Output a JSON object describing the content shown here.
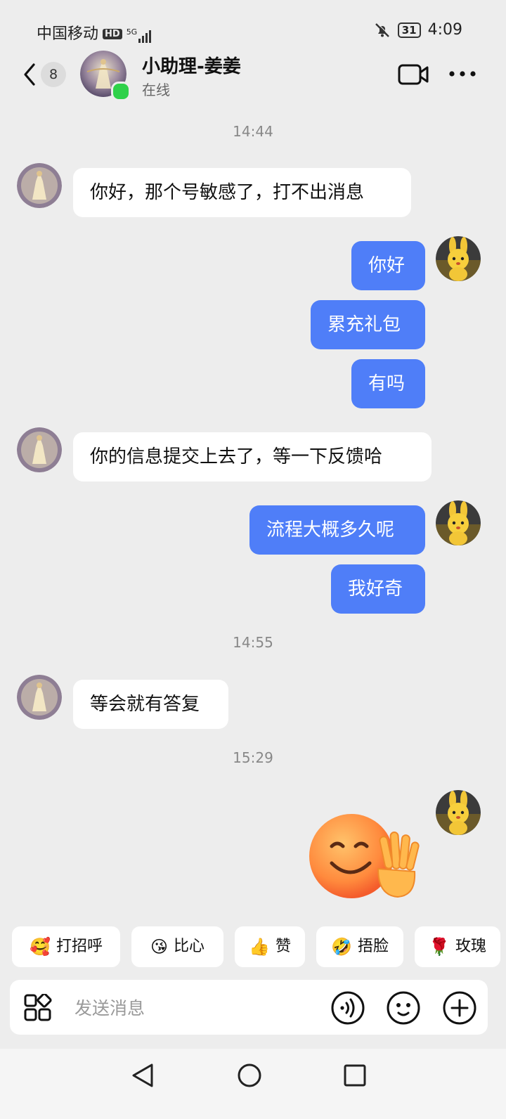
{
  "status_bar": {
    "carrier": "中国移动",
    "hd": "HD",
    "network": "5G",
    "battery": "31",
    "time": "4:09"
  },
  "header": {
    "unread_count": "8",
    "contact_name": "小助理-姜姜",
    "contact_status": "在线"
  },
  "messages": [
    {
      "type": "time",
      "text": "14:44"
    },
    {
      "type": "in",
      "text": "你好，那个号敏感了，打不出消息"
    },
    {
      "type": "out",
      "text": "你好"
    },
    {
      "type": "out",
      "text": "累充礼包"
    },
    {
      "type": "out",
      "text": "有吗"
    },
    {
      "type": "in",
      "text": "你的信息提交上去了，等一下反馈哈"
    },
    {
      "type": "out",
      "text": "流程大概多久呢"
    },
    {
      "type": "out",
      "text": "我好奇"
    },
    {
      "type": "time",
      "text": "14:55"
    },
    {
      "type": "in",
      "text": "等会就有答复"
    },
    {
      "type": "time",
      "text": "15:29"
    },
    {
      "type": "out-sticker",
      "sticker": "smiling-waving-face"
    }
  ],
  "quick_replies": [
    {
      "icon": "🥰",
      "label": "打招呼"
    },
    {
      "icon": "😘",
      "label": "比心"
    },
    {
      "icon": "👍",
      "label": "赞"
    },
    {
      "icon": "🤣",
      "label": "捂脸"
    },
    {
      "icon": "🌹",
      "label": "玫瑰"
    }
  ],
  "input": {
    "placeholder": "发送消息"
  },
  "colors": {
    "accent": "#4f7ef8",
    "online": "#2fd14a",
    "background": "#ededed"
  }
}
